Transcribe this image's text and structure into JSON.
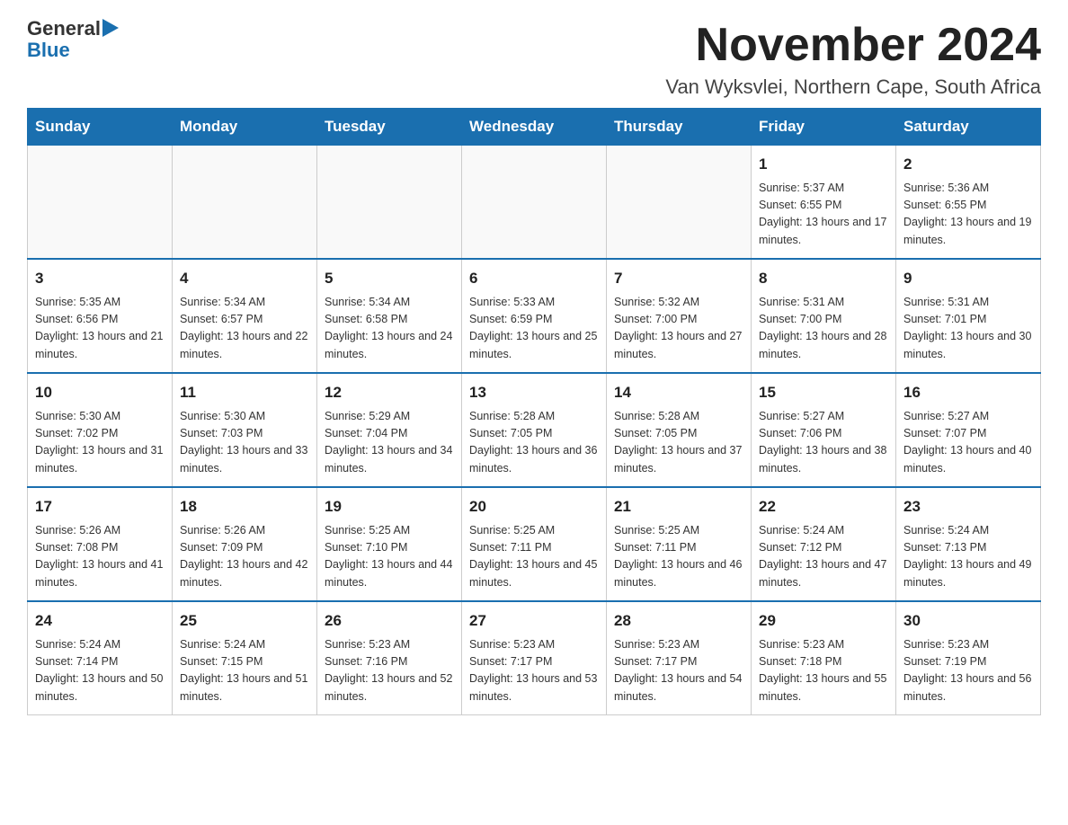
{
  "logo": {
    "general": "General",
    "blue": "Blue",
    "triangle_unicode": "▶"
  },
  "title": "November 2024",
  "location": "Van Wyksvlei, Northern Cape, South Africa",
  "weekdays": [
    "Sunday",
    "Monday",
    "Tuesday",
    "Wednesday",
    "Thursday",
    "Friday",
    "Saturday"
  ],
  "weeks": [
    [
      {
        "day": "",
        "sunrise": "",
        "sunset": "",
        "daylight": ""
      },
      {
        "day": "",
        "sunrise": "",
        "sunset": "",
        "daylight": ""
      },
      {
        "day": "",
        "sunrise": "",
        "sunset": "",
        "daylight": ""
      },
      {
        "day": "",
        "sunrise": "",
        "sunset": "",
        "daylight": ""
      },
      {
        "day": "",
        "sunrise": "",
        "sunset": "",
        "daylight": ""
      },
      {
        "day": "1",
        "sunrise": "Sunrise: 5:37 AM",
        "sunset": "Sunset: 6:55 PM",
        "daylight": "Daylight: 13 hours and 17 minutes."
      },
      {
        "day": "2",
        "sunrise": "Sunrise: 5:36 AM",
        "sunset": "Sunset: 6:55 PM",
        "daylight": "Daylight: 13 hours and 19 minutes."
      }
    ],
    [
      {
        "day": "3",
        "sunrise": "Sunrise: 5:35 AM",
        "sunset": "Sunset: 6:56 PM",
        "daylight": "Daylight: 13 hours and 21 minutes."
      },
      {
        "day": "4",
        "sunrise": "Sunrise: 5:34 AM",
        "sunset": "Sunset: 6:57 PM",
        "daylight": "Daylight: 13 hours and 22 minutes."
      },
      {
        "day": "5",
        "sunrise": "Sunrise: 5:34 AM",
        "sunset": "Sunset: 6:58 PM",
        "daylight": "Daylight: 13 hours and 24 minutes."
      },
      {
        "day": "6",
        "sunrise": "Sunrise: 5:33 AM",
        "sunset": "Sunset: 6:59 PM",
        "daylight": "Daylight: 13 hours and 25 minutes."
      },
      {
        "day": "7",
        "sunrise": "Sunrise: 5:32 AM",
        "sunset": "Sunset: 7:00 PM",
        "daylight": "Daylight: 13 hours and 27 minutes."
      },
      {
        "day": "8",
        "sunrise": "Sunrise: 5:31 AM",
        "sunset": "Sunset: 7:00 PM",
        "daylight": "Daylight: 13 hours and 28 minutes."
      },
      {
        "day": "9",
        "sunrise": "Sunrise: 5:31 AM",
        "sunset": "Sunset: 7:01 PM",
        "daylight": "Daylight: 13 hours and 30 minutes."
      }
    ],
    [
      {
        "day": "10",
        "sunrise": "Sunrise: 5:30 AM",
        "sunset": "Sunset: 7:02 PM",
        "daylight": "Daylight: 13 hours and 31 minutes."
      },
      {
        "day": "11",
        "sunrise": "Sunrise: 5:30 AM",
        "sunset": "Sunset: 7:03 PM",
        "daylight": "Daylight: 13 hours and 33 minutes."
      },
      {
        "day": "12",
        "sunrise": "Sunrise: 5:29 AM",
        "sunset": "Sunset: 7:04 PM",
        "daylight": "Daylight: 13 hours and 34 minutes."
      },
      {
        "day": "13",
        "sunrise": "Sunrise: 5:28 AM",
        "sunset": "Sunset: 7:05 PM",
        "daylight": "Daylight: 13 hours and 36 minutes."
      },
      {
        "day": "14",
        "sunrise": "Sunrise: 5:28 AM",
        "sunset": "Sunset: 7:05 PM",
        "daylight": "Daylight: 13 hours and 37 minutes."
      },
      {
        "day": "15",
        "sunrise": "Sunrise: 5:27 AM",
        "sunset": "Sunset: 7:06 PM",
        "daylight": "Daylight: 13 hours and 38 minutes."
      },
      {
        "day": "16",
        "sunrise": "Sunrise: 5:27 AM",
        "sunset": "Sunset: 7:07 PM",
        "daylight": "Daylight: 13 hours and 40 minutes."
      }
    ],
    [
      {
        "day": "17",
        "sunrise": "Sunrise: 5:26 AM",
        "sunset": "Sunset: 7:08 PM",
        "daylight": "Daylight: 13 hours and 41 minutes."
      },
      {
        "day": "18",
        "sunrise": "Sunrise: 5:26 AM",
        "sunset": "Sunset: 7:09 PM",
        "daylight": "Daylight: 13 hours and 42 minutes."
      },
      {
        "day": "19",
        "sunrise": "Sunrise: 5:25 AM",
        "sunset": "Sunset: 7:10 PM",
        "daylight": "Daylight: 13 hours and 44 minutes."
      },
      {
        "day": "20",
        "sunrise": "Sunrise: 5:25 AM",
        "sunset": "Sunset: 7:11 PM",
        "daylight": "Daylight: 13 hours and 45 minutes."
      },
      {
        "day": "21",
        "sunrise": "Sunrise: 5:25 AM",
        "sunset": "Sunset: 7:11 PM",
        "daylight": "Daylight: 13 hours and 46 minutes."
      },
      {
        "day": "22",
        "sunrise": "Sunrise: 5:24 AM",
        "sunset": "Sunset: 7:12 PM",
        "daylight": "Daylight: 13 hours and 47 minutes."
      },
      {
        "day": "23",
        "sunrise": "Sunrise: 5:24 AM",
        "sunset": "Sunset: 7:13 PM",
        "daylight": "Daylight: 13 hours and 49 minutes."
      }
    ],
    [
      {
        "day": "24",
        "sunrise": "Sunrise: 5:24 AM",
        "sunset": "Sunset: 7:14 PM",
        "daylight": "Daylight: 13 hours and 50 minutes."
      },
      {
        "day": "25",
        "sunrise": "Sunrise: 5:24 AM",
        "sunset": "Sunset: 7:15 PM",
        "daylight": "Daylight: 13 hours and 51 minutes."
      },
      {
        "day": "26",
        "sunrise": "Sunrise: 5:23 AM",
        "sunset": "Sunset: 7:16 PM",
        "daylight": "Daylight: 13 hours and 52 minutes."
      },
      {
        "day": "27",
        "sunrise": "Sunrise: 5:23 AM",
        "sunset": "Sunset: 7:17 PM",
        "daylight": "Daylight: 13 hours and 53 minutes."
      },
      {
        "day": "28",
        "sunrise": "Sunrise: 5:23 AM",
        "sunset": "Sunset: 7:17 PM",
        "daylight": "Daylight: 13 hours and 54 minutes."
      },
      {
        "day": "29",
        "sunrise": "Sunrise: 5:23 AM",
        "sunset": "Sunset: 7:18 PM",
        "daylight": "Daylight: 13 hours and 55 minutes."
      },
      {
        "day": "30",
        "sunrise": "Sunrise: 5:23 AM",
        "sunset": "Sunset: 7:19 PM",
        "daylight": "Daylight: 13 hours and 56 minutes."
      }
    ]
  ]
}
